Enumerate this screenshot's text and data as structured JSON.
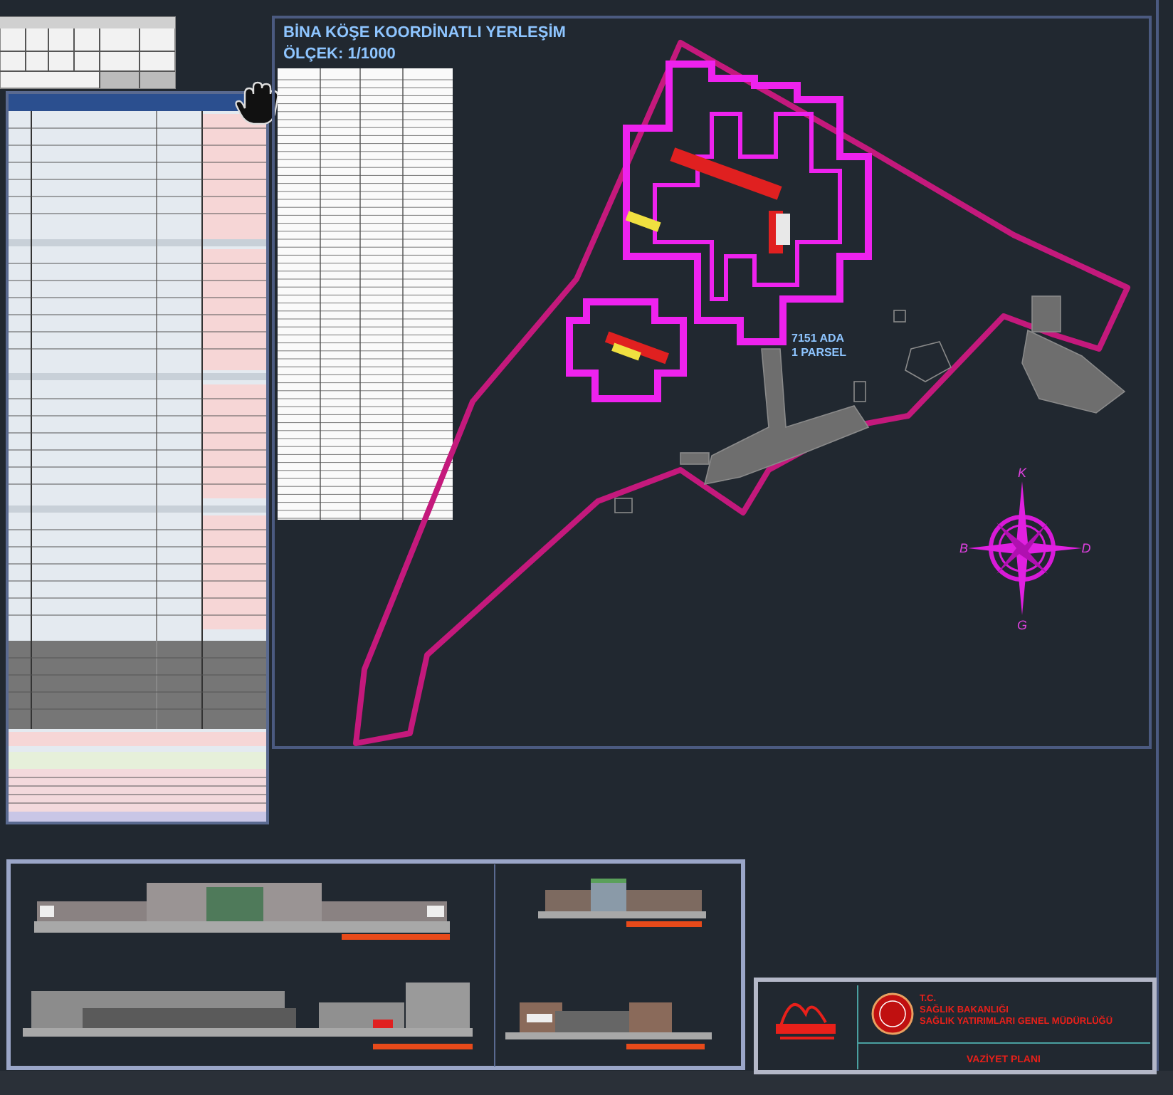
{
  "plan": {
    "title": "BİNA KÖŞE KOORDİNATLI YERLEŞİM",
    "scale": "ÖLÇEK: 1/1000",
    "parcel": [
      "7151 ADA",
      "1 PARSEL"
    ],
    "compass": {
      "north": "K",
      "west": "B",
      "east": "D",
      "south": "G"
    }
  },
  "title_block": {
    "lines": [
      "T.C.",
      "SAĞLIK BAKANLIĞI",
      "SAĞLIK YATIRIMLARI GENEL MÜDÜRLÜĞÜ"
    ],
    "sheet": "VAZİYET PLANI"
  }
}
